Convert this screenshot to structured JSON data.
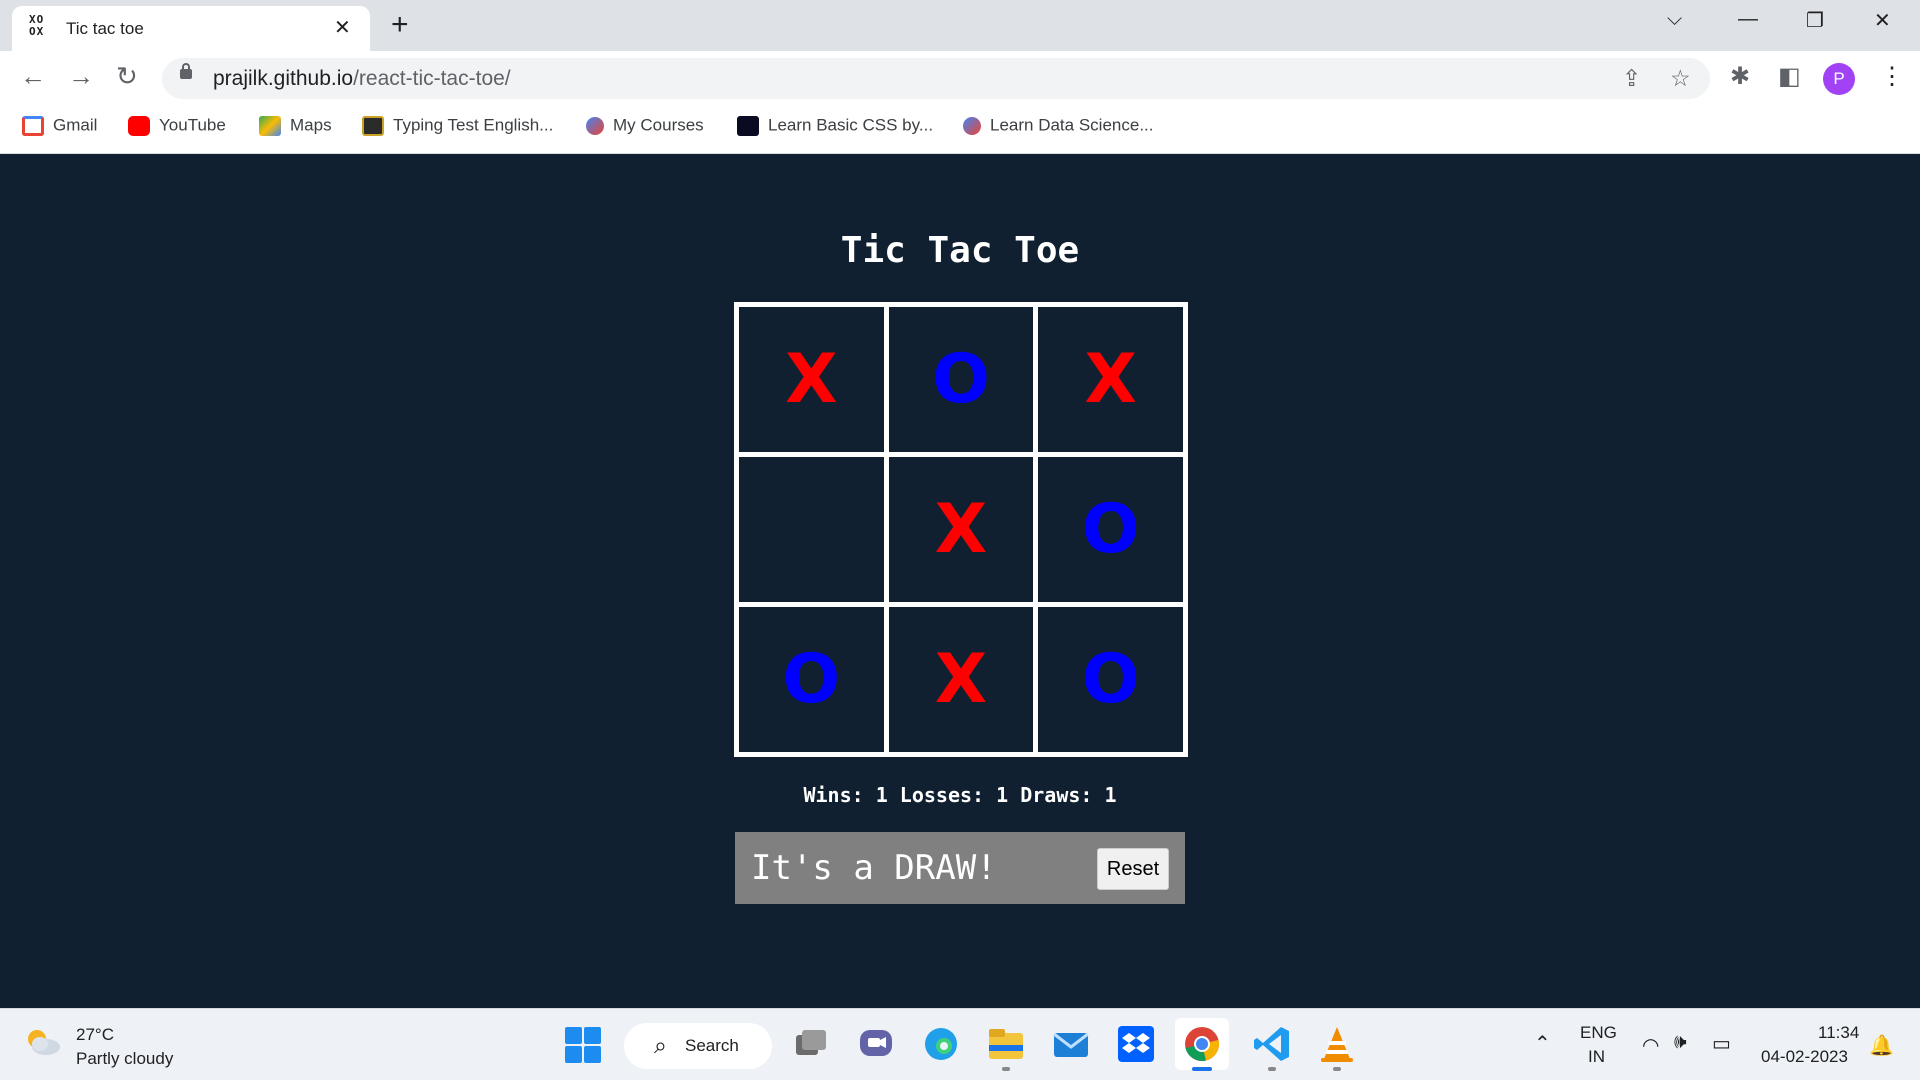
{
  "browser": {
    "tab_title": "Tic tac toe",
    "tab_close": "✕",
    "new_tab": "+",
    "url_host": "prajilk.github.io",
    "url_path": "/react-tic-tac-toe/",
    "profile_initial": "P",
    "bookmarks": [
      {
        "label": "Gmail",
        "icon": "gmail-icon",
        "color": "#ea4335"
      },
      {
        "label": "YouTube",
        "icon": "youtube-icon",
        "color": "#ff0000"
      },
      {
        "label": "Maps",
        "icon": "maps-icon",
        "color": "#34a853"
      },
      {
        "label": "Typing Test English...",
        "icon": "typing-test-icon",
        "color": "#3c4043"
      },
      {
        "label": "My Courses",
        "icon": "courses-icon",
        "color": "#4285f4"
      },
      {
        "label": "Learn Basic CSS by...",
        "icon": "freecodecamp-icon",
        "color": "#0a0a23"
      },
      {
        "label": "Learn Data Science...",
        "icon": "courses-icon",
        "color": "#4285f4"
      }
    ]
  },
  "game": {
    "title": "Tic Tac Toe",
    "board": [
      "X",
      "O",
      "X",
      "",
      "X",
      "O",
      "O",
      "X",
      "O"
    ],
    "colors": {
      "x": "#ff0000",
      "o": "#0000ff",
      "background": "#112030"
    },
    "score": "Wins: 1 Losses: 1 Draws: 1",
    "status": "It's a DRAW!",
    "reset_label": "Reset"
  },
  "taskbar": {
    "temperature": "27°C",
    "weather": "Partly cloudy",
    "search_label": "Search",
    "language_line1": "ENG",
    "language_line2": "IN",
    "time": "11:34",
    "date": "04-02-2023"
  }
}
